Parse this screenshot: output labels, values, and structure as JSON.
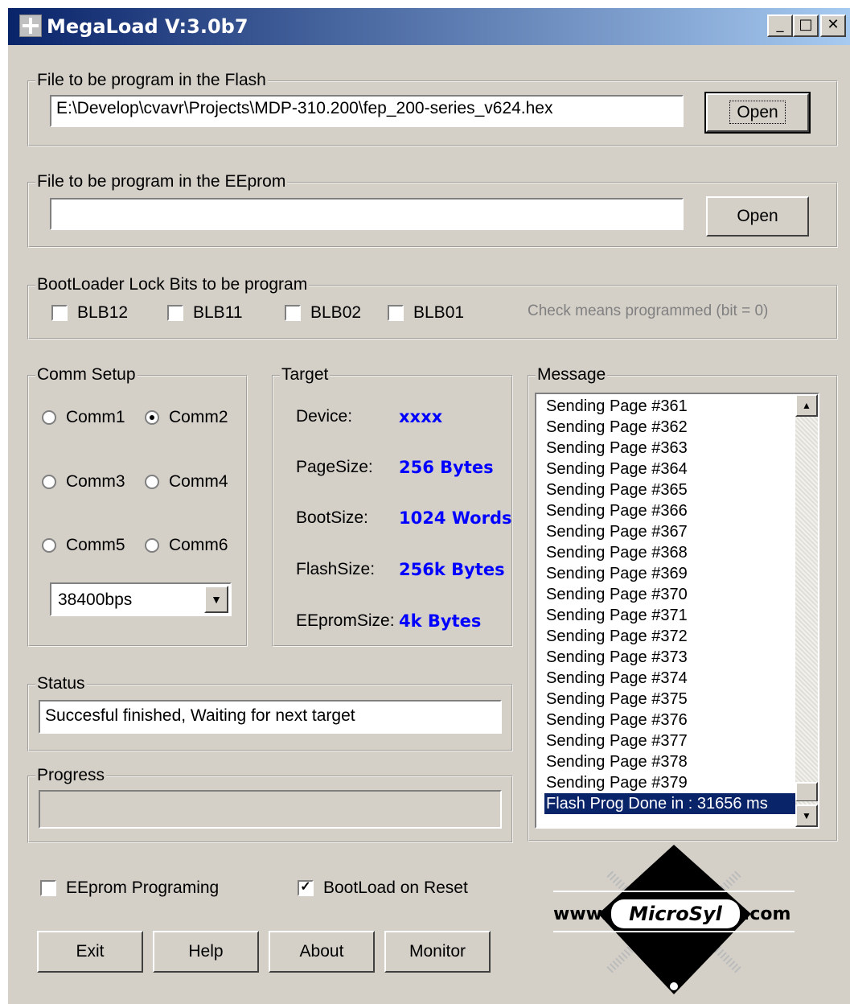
{
  "window": {
    "title": "MegaLoad V:3.0b7",
    "min_label": "_",
    "max_label": "□",
    "close_label": "✕"
  },
  "flash": {
    "label": "File to be program in the Flash",
    "path": "E:\\Develop\\cvavr\\Projects\\MDP-310.200\\fep_200-series_v624.hex",
    "open_label": "Open"
  },
  "eeprom": {
    "label": "File to be program in the EEprom",
    "path": "",
    "open_label": "Open"
  },
  "lockbits": {
    "label": "BootLoader Lock Bits to be program",
    "items": [
      {
        "label": "BLB12",
        "checked": false
      },
      {
        "label": "BLB11",
        "checked": false
      },
      {
        "label": "BLB02",
        "checked": false
      },
      {
        "label": "BLB01",
        "checked": false
      }
    ],
    "hint": "Check means programmed (bit = 0)"
  },
  "comm": {
    "label": "Comm Setup",
    "ports": [
      {
        "label": "Comm1",
        "selected": false
      },
      {
        "label": "Comm2",
        "selected": true
      },
      {
        "label": "Comm3",
        "selected": false
      },
      {
        "label": "Comm4",
        "selected": false
      },
      {
        "label": "Comm5",
        "selected": false
      },
      {
        "label": "Comm6",
        "selected": false
      }
    ],
    "baud": "38400bps"
  },
  "target": {
    "label": "Target",
    "rows": [
      {
        "label": "Device:",
        "value": "xxxx"
      },
      {
        "label": "PageSize:",
        "value": "256 Bytes"
      },
      {
        "label": "BootSize:",
        "value": "1024 Words"
      },
      {
        "label": "FlashSize:",
        "value": "256k Bytes"
      },
      {
        "label": "EEpromSize:",
        "value": "4k Bytes"
      }
    ]
  },
  "message": {
    "label": "Message",
    "lines": [
      "Sending Page #361",
      "Sending Page #362",
      "Sending Page #363",
      "Sending Page #364",
      "Sending Page #365",
      "Sending Page #366",
      "Sending Page #367",
      "Sending Page #368",
      "Sending Page #369",
      "Sending Page #370",
      "Sending Page #371",
      "Sending Page #372",
      "Sending Page #373",
      "Sending Page #374",
      "Sending Page #375",
      "Sending Page #376",
      "Sending Page #377",
      "Sending Page #378",
      "Sending Page #379",
      "Flash Prog Done in : 31656 ms"
    ],
    "selected_index": 19
  },
  "status": {
    "label": "Status",
    "text": "Succesful finished, Waiting for next target"
  },
  "progress": {
    "label": "Progress",
    "value": 0
  },
  "options": {
    "eeprom_programming": {
      "label": "EEprom Programing",
      "checked": false
    },
    "bootload_on_reset": {
      "label": "BootLoad on Reset",
      "checked": true
    }
  },
  "buttons": {
    "exit": "Exit",
    "help": "Help",
    "about": "About",
    "monitor": "Monitor"
  },
  "logo": {
    "prefix": "www.",
    "name": "MicroSyl",
    "suffix": ".com"
  },
  "colors": {
    "face": "#d4d0c8",
    "title_start": "#0a246a",
    "title_end": "#a6caf0",
    "target_value": "#0000ff",
    "selection": "#0a246a"
  }
}
